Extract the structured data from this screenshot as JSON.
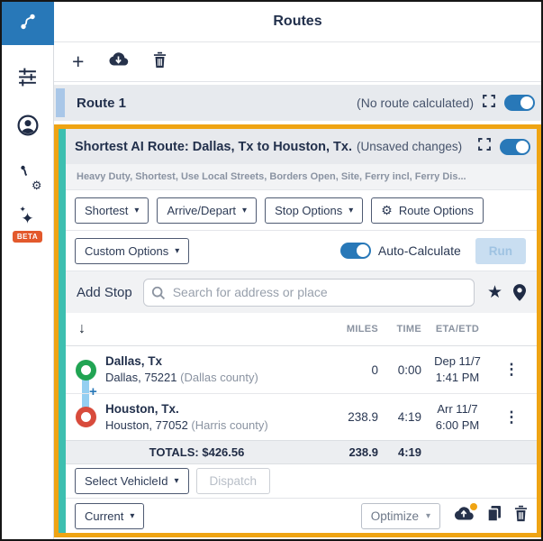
{
  "app": {
    "title": "Routes"
  },
  "colors": {
    "accent_blue": "#2878b8",
    "highlight_orange": "#efa413",
    "active_teal": "#3dbfb0",
    "origin_green": "#21a453",
    "destination_red": "#d84b3c",
    "connector_blue": "#94cff1",
    "beta_badge": "#e3592c"
  },
  "icons": {
    "plus": "+",
    "caret_down": "▾",
    "gear": "⚙",
    "star": "★",
    "kebab": "⋮",
    "down_arrow": "↓",
    "sparkle": "✦",
    "insert_plus": "+"
  },
  "sidebar": {
    "beta_label": "BETA"
  },
  "route1": {
    "title": "Route 1",
    "status": "(No route calculated)"
  },
  "active_route": {
    "title": "Shortest AI Route: Dallas, Tx to Houston, Tx.",
    "status": "(Unsaved changes)",
    "options_summary": "Heavy Duty, Shortest, Use Local Streets, Borders Open, Site, Ferry incl, Ferry Dis...",
    "buttons": {
      "shortest": "Shortest",
      "arrive_depart": "Arrive/Depart",
      "stop_options": "Stop Options",
      "route_options": "Route Options",
      "custom_options": "Custom Options",
      "auto_calculate": "Auto-Calculate",
      "run": "Run"
    },
    "add_stop": {
      "label": "Add Stop",
      "placeholder": "Search for address or place"
    },
    "table": {
      "headers": {
        "miles": "MILES",
        "time": "TIME",
        "eta": "ETA/ETD"
      },
      "stops": [
        {
          "name": "Dallas, Tx",
          "address": "Dallas, 75221 ",
          "county": "(Dallas county)",
          "miles": "0",
          "time": "0:00",
          "eta_line1": "Dep 11/7",
          "eta_line2": "1:41 PM"
        },
        {
          "name": "Houston, Tx.",
          "address": "Houston, 77052 ",
          "county": "(Harris county)",
          "miles": "238.9",
          "time": "4:19",
          "eta_line1": "Arr 11/7",
          "eta_line2": "6:00 PM"
        }
      ],
      "totals": {
        "label": "TOTALS: $426.56",
        "miles": "238.9",
        "time": "4:19"
      }
    },
    "footer": {
      "select_vehicle": "Select VehicleId",
      "dispatch": "Dispatch",
      "current": "Current",
      "optimize": "Optimize"
    }
  }
}
